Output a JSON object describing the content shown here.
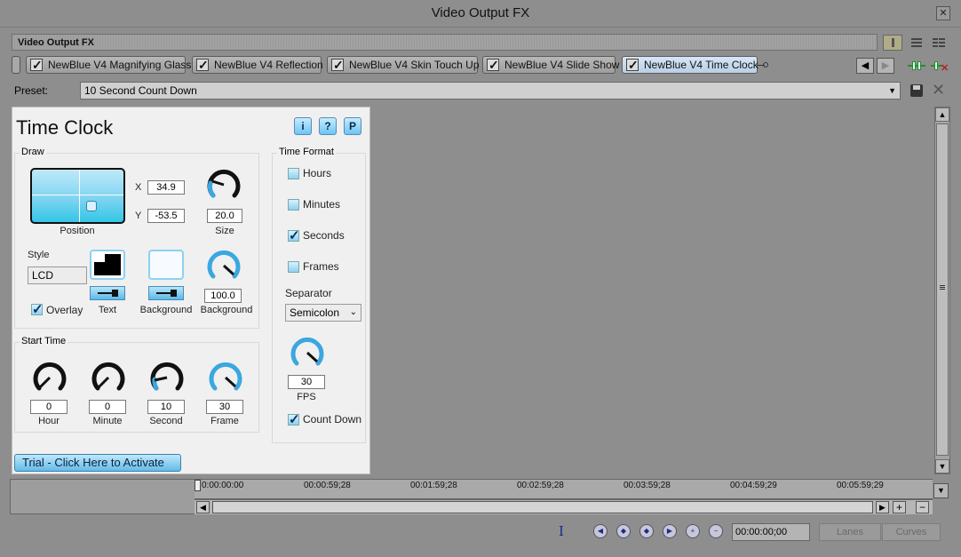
{
  "window": {
    "title": "Video Output FX",
    "close_glyph": "✕"
  },
  "header": {
    "label": "Video Output FX"
  },
  "chain": {
    "tabs": [
      {
        "label": "NewBlue V4 Magnifying Glass",
        "checked": true
      },
      {
        "label": "NewBlue V4 Reflection",
        "checked": true
      },
      {
        "label": "NewBlue V4 Skin Touch Up",
        "checked": true
      },
      {
        "label": "NewBlue V4 Slide Show",
        "checked": true
      },
      {
        "label": "NewBlue V4 Time Clock",
        "checked": true,
        "active": true
      }
    ],
    "prev_glyph": "◀",
    "next_glyph": "▶"
  },
  "preset": {
    "label": "Preset:",
    "value": "10 Second Count Down",
    "caret": "▼"
  },
  "panel": {
    "title": "Time Clock",
    "help_buttons": [
      "i",
      "?",
      "P"
    ],
    "draw": {
      "label": "Draw",
      "x_label": "X",
      "x_value": "34.9",
      "y_label": "Y",
      "y_value": "-53.5",
      "position_label": "Position",
      "size_value": "20.0",
      "size_label": "Size",
      "style_label": "Style",
      "style_value": "LCD",
      "overlay_label": "Overlay",
      "overlay_checked": true,
      "text_label": "Text",
      "background_label": "Background",
      "background_value": "100.0",
      "background_label_2": "Background"
    },
    "start_time": {
      "label": "Start Time",
      "fields": [
        {
          "value": "0",
          "label": "Hour"
        },
        {
          "value": "0",
          "label": "Minute"
        },
        {
          "value": "10",
          "label": "Second"
        },
        {
          "value": "30",
          "label": "Frame"
        }
      ]
    },
    "time_format": {
      "label": "Time Format",
      "options": [
        {
          "label": "Hours",
          "checked": false
        },
        {
          "label": "Minutes",
          "checked": false
        },
        {
          "label": "Seconds",
          "checked": true
        },
        {
          "label": "Frames",
          "checked": false
        }
      ],
      "separator_label": "Separator",
      "separator_value": "Semicolon",
      "fps_value": "30",
      "fps_label": "FPS",
      "count_down_label": "Count Down",
      "count_down_checked": true
    },
    "activate_label": "Trial - Click Here to Activate"
  },
  "timeline": {
    "ticks": [
      "0:00:00:00",
      "00:00:59;28",
      "00:01:59;28",
      "00:02:59;28",
      "00:03:59;28",
      "00:04:59;29",
      "00:05:59;29"
    ],
    "time_value": "00:00:00;00",
    "lanes_label": "Lanes",
    "curves_label": "Curves"
  },
  "colors": {
    "accent": "#6cc5f3",
    "panel_bg": "#f0f0f0",
    "app_bg": "#8e8e8e"
  }
}
